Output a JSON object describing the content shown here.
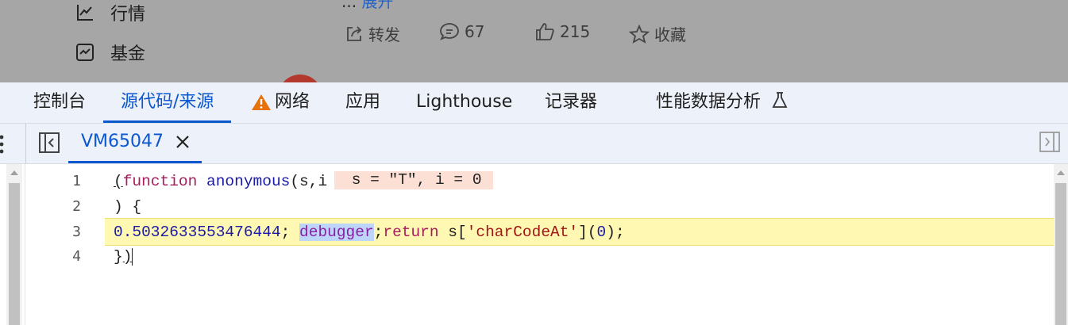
{
  "background_page": {
    "nav": [
      {
        "label": "行情",
        "icon": "trend-chart-icon"
      },
      {
        "label": "基金",
        "icon": "fund-chart-icon"
      }
    ],
    "post_snippet": "...",
    "post_link": "展开",
    "actions": {
      "share": "转发",
      "comments": "67",
      "likes": "215",
      "favorite": "收藏"
    }
  },
  "devtools": {
    "panel_tabs": [
      "控制台",
      "源代码/来源",
      "网络",
      "应用",
      "Lighthouse",
      "记录器",
      "性能数据分析"
    ],
    "active_panel": "源代码/来源",
    "file_tab": "VM65047",
    "code": {
      "line_numbers": [
        "1",
        "2",
        "3",
        "4"
      ],
      "line1": {
        "paren": "(",
        "kw": "function",
        "name": "anonymous",
        "params": "(s,i"
      },
      "inline_values": " s = \"T\", i = 0",
      "line2": ") {",
      "line3": {
        "num": "0.5032633553476444",
        "semi": "; ",
        "debugger": "debugger",
        "rest1": ";",
        "ret": "return",
        "rest2": " s[",
        "str": "'charCodeAt'",
        "rest3": "](",
        "zero": "0",
        "rest4": ");"
      },
      "line4": {
        "a": "}",
        "b": ")"
      }
    },
    "colors": {
      "accent": "#0b57d0",
      "exec_line": "#fff8b3",
      "warning": "#e8710a"
    }
  }
}
